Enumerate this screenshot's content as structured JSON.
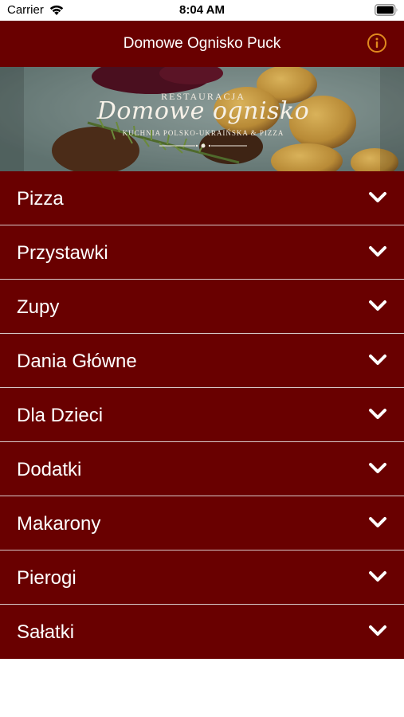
{
  "status_bar": {
    "carrier": "Carrier",
    "time": "8:04 AM"
  },
  "nav": {
    "title": "Domowe Ognisko Puck",
    "info_icon": "info-circle-icon",
    "accent_color": "#e08a1e"
  },
  "hero": {
    "kicker": "RESTAURACJA",
    "name": "Domowe ognisko",
    "tagline": "KUCHNIA POLSKO-UKRAIŃSKA & PIZZA"
  },
  "theme": {
    "bar_color": "#690000",
    "text_color": "#ffffff"
  },
  "menu": {
    "categories": [
      {
        "label": "Pizza"
      },
      {
        "label": "Przystawki"
      },
      {
        "label": "Zupy"
      },
      {
        "label": "Dania Główne"
      },
      {
        "label": "Dla Dzieci"
      },
      {
        "label": "Dodatki"
      },
      {
        "label": "Makarony"
      },
      {
        "label": "Pierogi"
      },
      {
        "label": "Sałatki"
      }
    ],
    "expand_icon": "chevron-down-icon"
  }
}
